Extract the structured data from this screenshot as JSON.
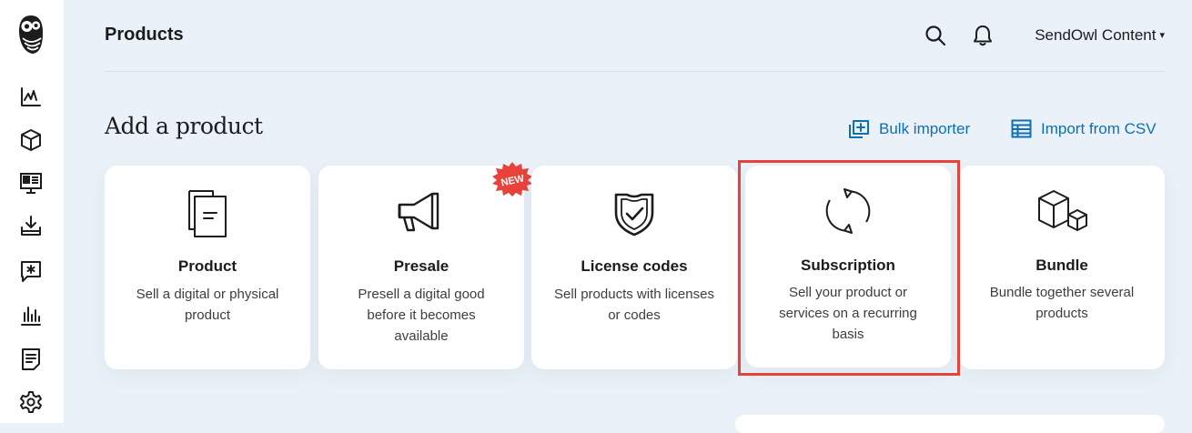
{
  "header": {
    "page_title": "Products",
    "account_name": "SendOwl Content",
    "account_caret": "▾"
  },
  "section": {
    "title": "Add a product",
    "links": {
      "bulk_importer": "Bulk importer",
      "import_csv": "Import from CSV"
    }
  },
  "cards": [
    {
      "title": "Product",
      "desc": "Sell a digital or physical product",
      "icon": "document-icon"
    },
    {
      "title": "Presale",
      "desc": "Presell a digital good before it becomes available",
      "icon": "megaphone-icon",
      "badge": "NEW"
    },
    {
      "title": "License codes",
      "desc": "Sell products with licenses or codes",
      "icon": "shield-check-icon"
    },
    {
      "title": "Subscription",
      "desc": "Sell your product or services on a recurring basis",
      "icon": "recurring-icon"
    },
    {
      "title": "Bundle",
      "desc": "Bundle together several products",
      "icon": "boxes-icon"
    }
  ],
  "sidebar": {
    "icons": [
      "dashboard-icon",
      "products-icon",
      "storefront-icon",
      "downloads-icon",
      "messages-icon",
      "reports-icon",
      "orders-icon",
      "settings-icon"
    ]
  },
  "colors": {
    "background": "#eaf1f8",
    "link": "#0f6fb3",
    "highlight": "#e8433b",
    "badge": "#e8433b"
  }
}
